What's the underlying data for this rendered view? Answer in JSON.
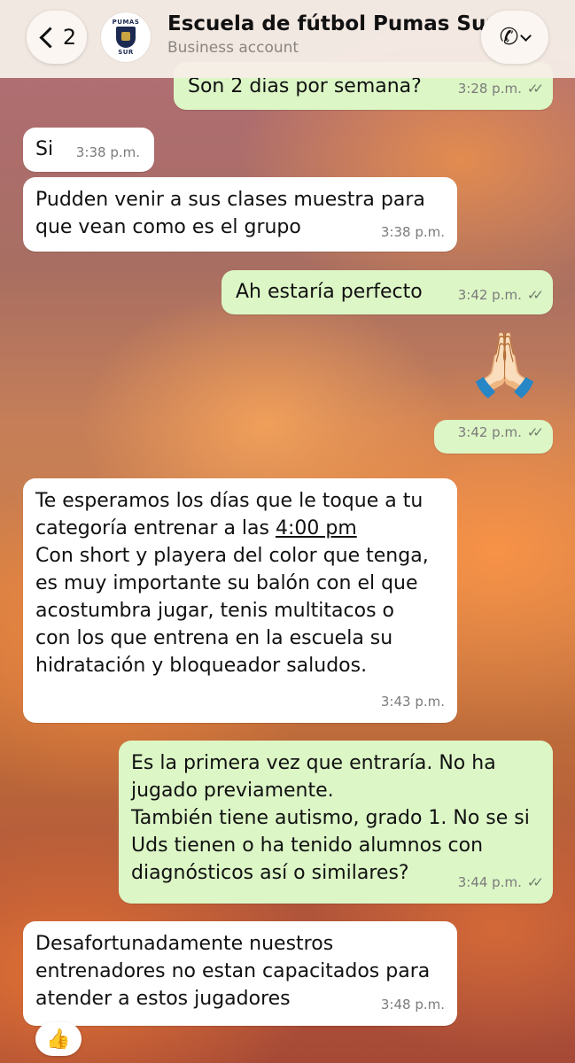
{
  "header": {
    "back_count": "2",
    "avatar_top": "PUMAS",
    "avatar_bottom": "SUR",
    "title": "Escuela de fútbol Pumas Sur",
    "subtitle": "Business account",
    "phone_icon": "phone-icon"
  },
  "messages": [
    {
      "direction": "out",
      "text": "Son 2 dias por semana?",
      "time": "3:28 p.m.",
      "read": true
    },
    {
      "direction": "in",
      "text": "Si",
      "time": "3:38 p.m."
    },
    {
      "direction": "in",
      "text": "Pudden venir a sus clases muestra para\nque vean como es el grupo",
      "time": "3:38 p.m."
    },
    {
      "direction": "out",
      "text": "Ah estaría perfecto",
      "time": "3:42 p.m.",
      "read": true
    },
    {
      "direction": "out",
      "emoji": "🙏🏻",
      "time": "3:42 p.m.",
      "read": true
    },
    {
      "direction": "in",
      "text_before_link": "Te esperamos los días que le toque a tu\ncategoría entrenar a las ",
      "link": "4:00 pm",
      "text_after_link": "\nCon short y playera del color que tenga,\nes muy importante su balón con el que\nacostumbra jugar, tenis multitacos o\ncon los que entrena en la escuela su\nhidratación y bloqueador saludos.",
      "time": "3:43 p.m."
    },
    {
      "direction": "out",
      "text": "Es la primera vez que entraría. No ha\njugado previamente.\nTambién tiene autismo, grado 1. No se si\nUds tienen o ha tenido alumnos con\ndiagnósticos así o similares?",
      "time": "3:44 p.m.",
      "read": true
    },
    {
      "direction": "in",
      "text": "Desafortunadamente nuestros\nentrenadores no estan capacitados para\natender a estos jugadores",
      "time": "3:48 p.m.",
      "reaction": "👍"
    }
  ],
  "read_ticks": "✓✓"
}
